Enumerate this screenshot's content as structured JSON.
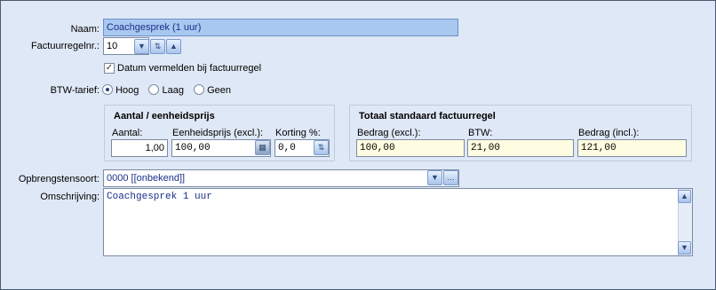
{
  "naam": {
    "label": "Naam:",
    "value": "Coachgesprek (1 uur)"
  },
  "factuurregelnr": {
    "label": "Factuurregelnr.:",
    "value": "10"
  },
  "datum_check": {
    "label": "Datum vermelden bij factuurregel",
    "checked": true
  },
  "btw": {
    "label": "BTW-tarief:",
    "options": [
      "Hoog",
      "Laag",
      "Geen"
    ],
    "selected": "Hoog"
  },
  "aantal_group": {
    "title": "Aantal / eenheidsprijs",
    "aantal_label": "Aantal:",
    "aantal_value": "1,00",
    "prijs_label": "Eenheidsprijs (excl.):",
    "prijs_value": "100,00",
    "korting_label": "Korting %:",
    "korting_value": "0,0"
  },
  "totaal_group": {
    "title": "Totaal standaard factuurregel",
    "bedrag_excl_label": "Bedrag (excl.):",
    "bedrag_excl_value": "100,00",
    "btw_label": "BTW:",
    "btw_value": "21,00",
    "bedrag_incl_label": "Bedrag (incl.):",
    "bedrag_incl_value": "121,00"
  },
  "opbrengstensoort": {
    "label": "Opbrengstensoort:",
    "value": "0000 [[onbekend]]"
  },
  "omschrijving": {
    "label": "Omschrijving:",
    "value": "Coachgesprek 1 uur"
  },
  "colors": {
    "background": "#dfe8f6",
    "selection": "#a8c8f0",
    "highlight_field": "#fffde1",
    "text_blue": "#1b2f8a"
  },
  "icons": [
    "chevron-down-icon",
    "spin-arrows-icon",
    "chevron-up-icon",
    "calculator-icon",
    "ellipsis-icon",
    "scroll-up-icon",
    "scroll-down-icon"
  ]
}
